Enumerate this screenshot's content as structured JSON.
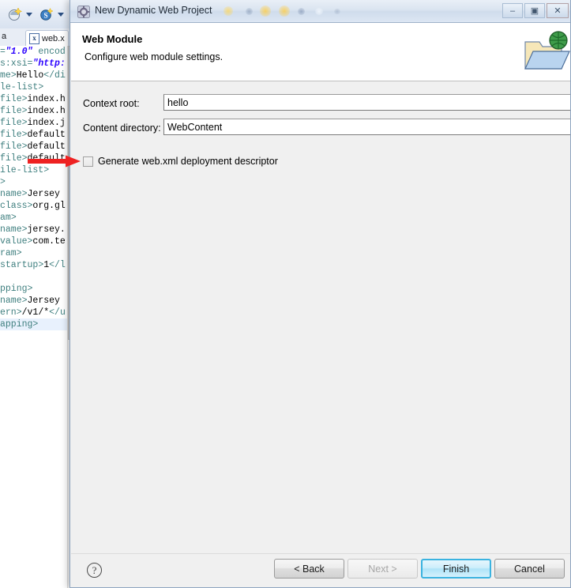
{
  "background_window": {
    "toolbar": {
      "items": [
        {
          "name": "new-wizard-icon",
          "label": ""
        },
        {
          "name": "new-wizard-dropdown-arrow",
          "label": ""
        },
        {
          "name": "save-icon",
          "label": ""
        },
        {
          "name": "save-dropdown-arrow",
          "label": ""
        }
      ]
    },
    "tabs": {
      "clipped_tab_label": "a",
      "active_tab_label": "web.x",
      "active_tab_icon": "xml-file-icon"
    },
    "editor": {
      "language": "xml",
      "lines": [
        "=\"1.0\" encod",
        "s:xsi=\"http:",
        "me>Hello</di",
        "le-list>",
        "file>index.h",
        "file>index.h",
        "file>index.j",
        "file>default",
        "file>default",
        "file>default",
        "ile-list>",
        ">",
        "name>Jersey",
        "class>org.gl",
        "am>",
        "name>jersey.",
        "value>com.te",
        "ram>",
        "startup>1</l",
        "",
        "pping>",
        "name>Jersey",
        "ern>/v1/*</u",
        "apping>"
      ]
    }
  },
  "dialog": {
    "titlebar": {
      "icon": "eclipse-wizard-icon",
      "title": "New Dynamic Web Project",
      "minimize_label": "–",
      "maximize_label": "▣",
      "close_label": "✕"
    },
    "header": {
      "title": "Web Module",
      "description": "Configure web module settings.",
      "icon": "web-module-folder-globe-icon"
    },
    "form": {
      "fields": [
        {
          "name": "context-root",
          "label": "Context root:",
          "value": "hello",
          "placeholder": ""
        },
        {
          "name": "content-directory",
          "label": "Content directory:",
          "value": "WebContent",
          "placeholder": ""
        }
      ],
      "checkbox": {
        "name": "generate-web-xml",
        "label": "Generate web.xml deployment descriptor",
        "checked": false
      }
    },
    "annotation": {
      "type": "red-arrow",
      "points_at": "generate-web-xml-checkbox",
      "color": "#ee2222"
    },
    "footer": {
      "help_label": "?",
      "buttons": [
        {
          "name": "back",
          "label": "< Back",
          "enabled": true,
          "default": false
        },
        {
          "name": "next",
          "label": "Next >",
          "enabled": false,
          "default": false
        },
        {
          "name": "finish",
          "label": "Finish",
          "enabled": true,
          "default": true
        },
        {
          "name": "cancel",
          "label": "Cancel",
          "enabled": true,
          "default": false
        }
      ]
    }
  },
  "colors": {
    "accent": "#3bb3e0",
    "annotation": "#ee2222",
    "dialog_bg": "#f0f0f0",
    "titlebar": "#dae4f0",
    "xml_tag": "#3f7f7f",
    "xml_value": "#2a00ff"
  }
}
